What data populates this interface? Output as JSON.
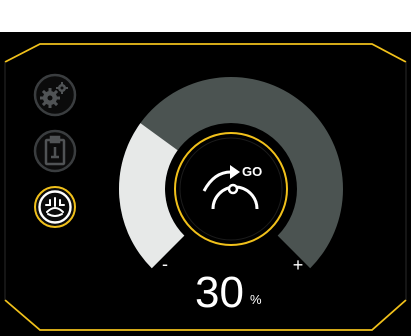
{
  "colors": {
    "background": "#000000",
    "frame": "#f1c11b",
    "arc_track": "#4b5351",
    "arc_fill": "#e7e9e8",
    "icon_inactive": "#505355",
    "icon_active": "#ffffff"
  },
  "sidebar": {
    "items": [
      {
        "icon": "gears-icon",
        "active": false
      },
      {
        "icon": "clipboard-icon",
        "active": false
      },
      {
        "icon": "lift-assist-icon",
        "active": true
      }
    ]
  },
  "gauge": {
    "level_percent": 30,
    "value": "30",
    "unit": "%",
    "min_label": "-",
    "max_label": "+",
    "center_icon": "go-arrow-icon",
    "center_label": "GO"
  }
}
